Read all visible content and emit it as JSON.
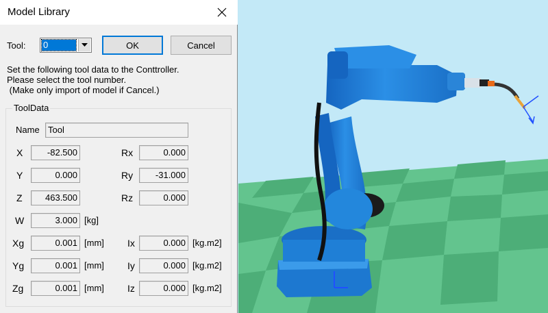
{
  "dialog": {
    "title": "Model Library",
    "tool_label": "Tool:",
    "tool_value": "0",
    "ok_label": "OK",
    "cancel_label": "Cancel",
    "info_lines": [
      "Set the following tool data to the Conttroller.",
      "Please select the tool number.",
      " (Make only import of model if Cancel.)"
    ],
    "group_title": "ToolData",
    "name_label": "Name",
    "name_value": "Tool",
    "fields": {
      "x": {
        "label": "X",
        "value": "-82.500"
      },
      "y": {
        "label": "Y",
        "value": "0.000"
      },
      "z": {
        "label": "Z",
        "value": "463.500"
      },
      "rx": {
        "label": "Rx",
        "value": "0.000"
      },
      "ry": {
        "label": "Ry",
        "value": "-31.000"
      },
      "rz": {
        "label": "Rz",
        "value": "0.000"
      },
      "w": {
        "label": "W",
        "value": "3.000",
        "unit": "[kg]"
      },
      "xg": {
        "label": "Xg",
        "value": "0.001",
        "unit": "[mm]"
      },
      "yg": {
        "label": "Yg",
        "value": "0.001",
        "unit": "[mm]"
      },
      "zg": {
        "label": "Zg",
        "value": "0.001",
        "unit": "[mm]"
      },
      "ix": {
        "label": "Ix",
        "value": "0.000",
        "unit": "[kg.m2]"
      },
      "iy": {
        "label": "Iy",
        "value": "0.000",
        "unit": "[kg.m2]"
      },
      "iz": {
        "label": "Iz",
        "value": "0.000",
        "unit": "[kg.m2]"
      }
    }
  },
  "icons": {
    "close": "close-icon",
    "dropdown": "chevron-down-icon"
  },
  "colors": {
    "robot_blue": "#1f7fd6",
    "floor_light": "#6fce9a",
    "floor_dark": "#4fb67e",
    "sky": "#c3e9f7",
    "selection": "#0078d7"
  }
}
